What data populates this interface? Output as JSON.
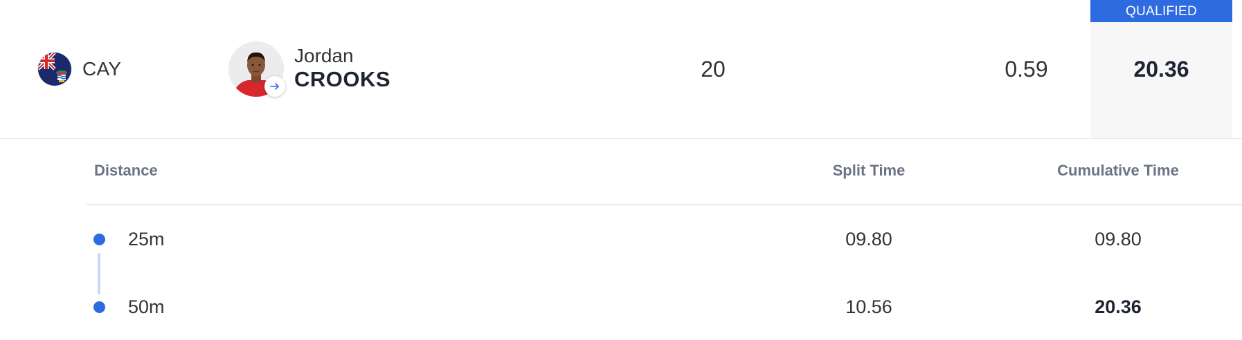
{
  "result": {
    "country_code": "CAY",
    "flag_icon": "cayman-islands-flag",
    "athlete": {
      "first_name": "Jordan",
      "last_name": "CROOKS"
    },
    "lane": "20",
    "reaction_time": "0.59",
    "status_badge": "QUALIFIED",
    "final_time": "20.36"
  },
  "splits": {
    "headers": {
      "distance": "Distance",
      "split_time": "Split Time",
      "cumulative_time": "Cumulative Time"
    },
    "rows": [
      {
        "distance": "25m",
        "split_time": "09.80",
        "cumulative_time": "09.80"
      },
      {
        "distance": "50m",
        "split_time": "10.56",
        "cumulative_time": "20.36"
      }
    ]
  },
  "colors": {
    "accent": "#2f6be0",
    "connector": "#c9d6f7",
    "final_bg": "#f7f7f8",
    "header_text": "#6b7385"
  }
}
